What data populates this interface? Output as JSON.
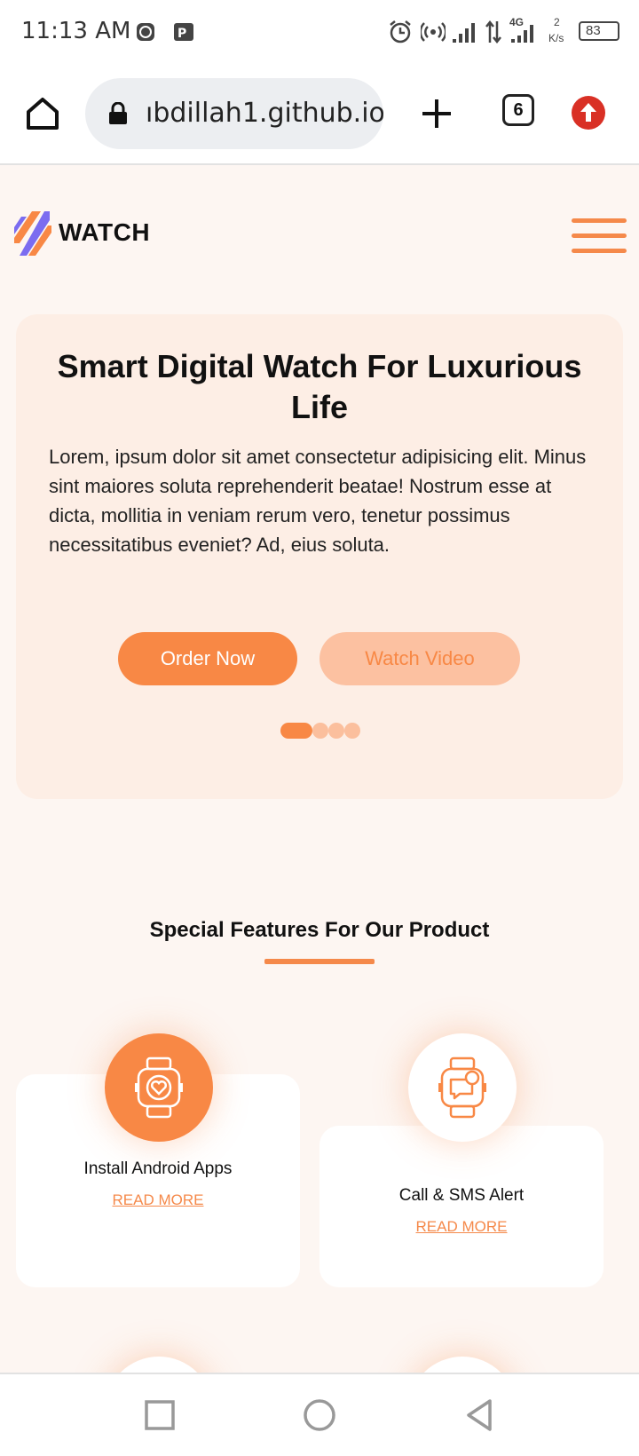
{
  "status_bar": {
    "time": "11:13 AM",
    "network_label": "4G",
    "speed_value": "2",
    "speed_unit": "K/s",
    "battery": "83"
  },
  "browser": {
    "url": "ıbdillah1.github.io",
    "tab_count": "6"
  },
  "site": {
    "brand": "WATCH",
    "accent_color": "#f88845",
    "logo_colors": [
      "#f88845",
      "#7b6cf0"
    ]
  },
  "hero": {
    "title": "Smart Digital Watch For Luxurious Life",
    "body": "Lorem, ipsum dolor sit amet consectetur adipisicing elit. Minus sint maiores soluta reprehenderit beatae! Nostrum esse at dicta, mollitia in veniam rerum vero, tenetur possimus necessitatibus eveniet? Ad, eius soluta.",
    "order_label": "Order Now",
    "video_label": "Watch Video",
    "slide_count": 4,
    "active_slide": 1
  },
  "features": {
    "title": "Special Features For Our Product",
    "cards": [
      {
        "label": "Install Android Apps",
        "link": "READ MORE",
        "icon": "smartwatch-heart-icon",
        "active": true
      },
      {
        "label": "Call & SMS Alert",
        "link": "READ MORE",
        "icon": "smartwatch-chat-icon",
        "active": false
      }
    ]
  }
}
